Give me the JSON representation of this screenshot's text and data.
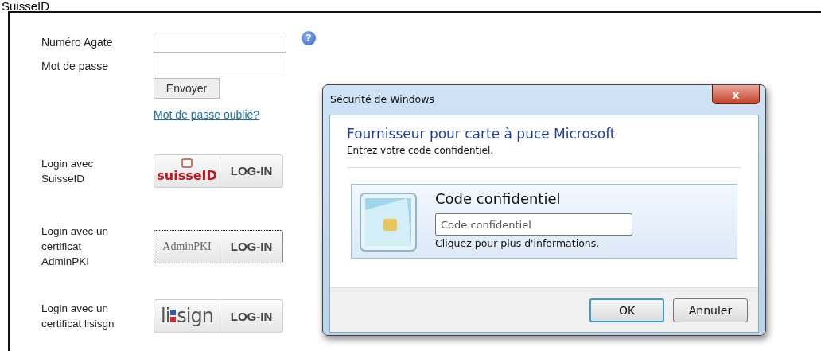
{
  "page_title": "SuisseID",
  "form": {
    "fields": [
      {
        "label": "Numéro Agate",
        "help": "?"
      },
      {
        "label": "Mot de passe"
      }
    ],
    "submit": "Envoyer",
    "forgot_link": "Mot de passe oublié?"
  },
  "logins": [
    {
      "kind": "suisseid",
      "label": "Login avec SuisseID",
      "brand": "suisseID",
      "action": "LOG-IN",
      "focused": false
    },
    {
      "kind": "adminpki",
      "label": "Login avec un certificat AdminPKI",
      "brand": "AdminPKI",
      "action": "LOG-IN",
      "focused": true
    },
    {
      "kind": "lisign",
      "label": "Login avec un certificat lisisgn",
      "brand": "sign",
      "brand_prefix": "li",
      "action": "LOG-IN",
      "focused": false
    }
  ],
  "dialog": {
    "title": "Sécurité de Windows",
    "close": "x",
    "heading": "Fournisseur pour carte à puce Microsoft",
    "instruction": "Entrez votre code confidentiel.",
    "tile_title": "Code confidentiel",
    "placeholder": "Code confidentiel",
    "more_link": "Cliquez pour plus d'informations.",
    "buttons": [
      {
        "label": "OK",
        "default": true
      },
      {
        "label": "Annuler",
        "default": false
      }
    ]
  }
}
